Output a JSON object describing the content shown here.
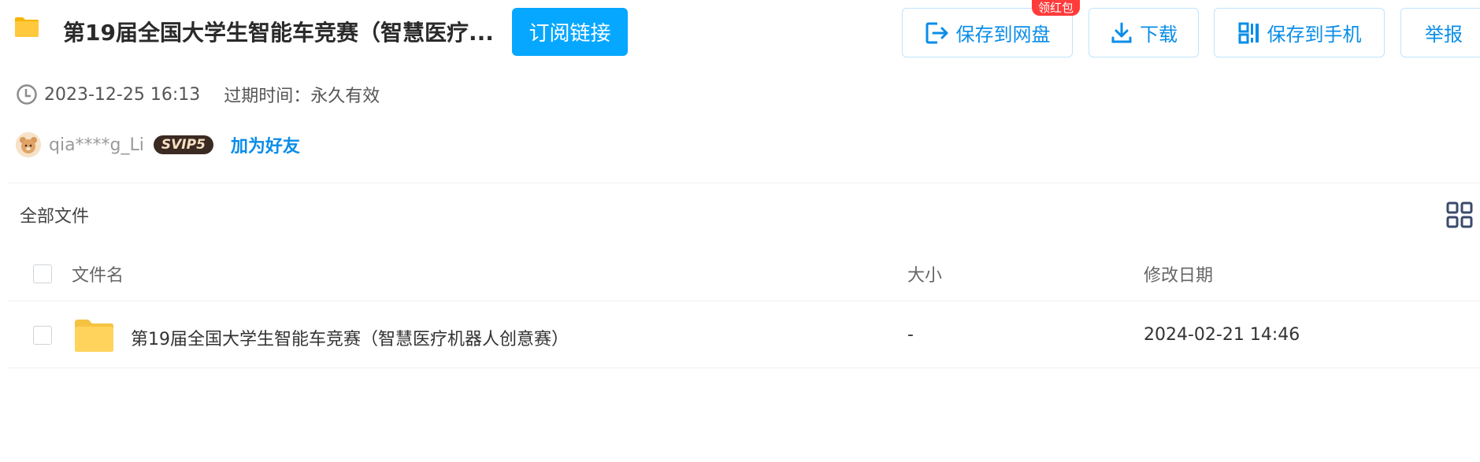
{
  "header": {
    "title": "第19届全国大学生智能车竞赛（智慧医疗...",
    "subscribe_label": "订阅链接",
    "buttons": {
      "save": "保存到网盘",
      "download": "下载",
      "save_phone": "保存到手机",
      "report": "举报"
    },
    "red_packet_badge": "领红包"
  },
  "meta": {
    "time": "2023-12-25 16:13",
    "expire": "过期时间：永久有效"
  },
  "user": {
    "name": "qia****g_Li",
    "vip_badge": "SVIP5",
    "add_friend": "加为好友"
  },
  "files": {
    "breadcrumb": "全部文件",
    "columns": {
      "name": "文件名",
      "size": "大小",
      "modified": "修改日期"
    },
    "rows": [
      {
        "name": "第19届全国大学生智能车竞赛（智慧医疗机器人创意赛）",
        "size": "-",
        "modified": "2024-02-21 14:46"
      }
    ]
  },
  "colors": {
    "accent": "#06a7ff",
    "link": "#0a8de8",
    "folder": "#ffd35c",
    "red_badge": "#ff3b3b"
  }
}
